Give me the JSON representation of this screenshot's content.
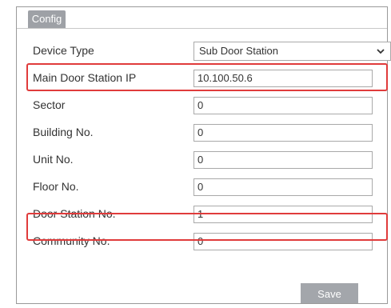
{
  "tab": {
    "label": "Config"
  },
  "form": {
    "device_type": {
      "label": "Device Type",
      "value": "Sub Door Station"
    },
    "main_door_station_ip": {
      "label": "Main Door Station IP",
      "value": "10.100.50.6"
    },
    "sector": {
      "label": "Sector",
      "value": "0"
    },
    "building_no": {
      "label": "Building No.",
      "value": "0"
    },
    "unit_no": {
      "label": "Unit No.",
      "value": "0"
    },
    "floor_no": {
      "label": "Floor No.",
      "value": "0"
    },
    "door_station_no": {
      "label": "Door Station No.",
      "value": "1"
    },
    "community_no": {
      "label": "Community No.",
      "value": "0"
    }
  },
  "actions": {
    "save_label": "Save"
  },
  "colors": {
    "highlight": "#e03b3b",
    "tab": "#9ea1a6",
    "button": "#a3a6ab"
  }
}
